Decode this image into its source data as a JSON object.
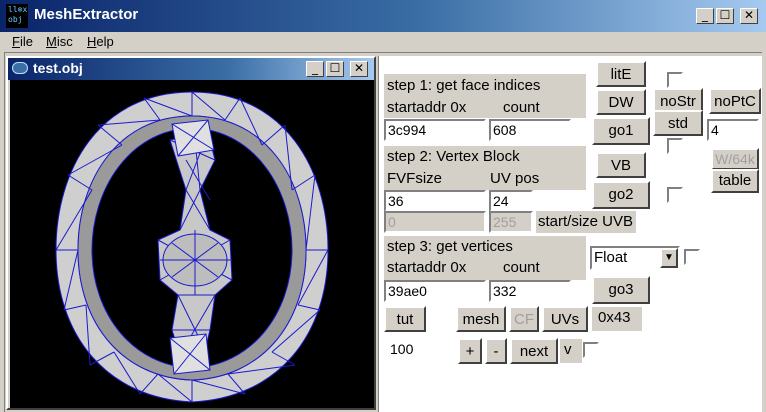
{
  "window": {
    "title": "MeshExtractor",
    "icon_text": "ll⊗x\nobj"
  },
  "caption_buttons": {
    "min": "_",
    "max": "☐",
    "close": "✕"
  },
  "menu": [
    {
      "label": "File",
      "underline": "F",
      "rest": "ile"
    },
    {
      "label": "Misc",
      "underline": "M",
      "rest": "isc"
    },
    {
      "label": "Help",
      "underline": "H",
      "rest": "elp"
    }
  ],
  "child_window": {
    "title": "test.obj"
  },
  "step1": {
    "title": "step 1: get face indices",
    "addr_label": "startaddr 0x",
    "count_label": "count",
    "addr_value": "3c994",
    "count_value": "608",
    "go_label": "go1"
  },
  "step2": {
    "title": "step 2: Vertex Block",
    "fvf_label": "FVFsize",
    "uv_label": "UV pos",
    "fvf_value": "36",
    "uv_value": "24",
    "uvb_start": "0",
    "uvb_size": "255",
    "uvb_label": "start/size UVB",
    "vb_label": "VB",
    "go_label": "go2"
  },
  "step3": {
    "title": "step 3: get vertices",
    "addr_label": "startaddr 0x",
    "count_label": "count",
    "addr_value": "39ae0",
    "count_value": "332",
    "format_value": "Float",
    "go_label": "go3"
  },
  "buttons": {
    "lite": "litE",
    "dw": "DW",
    "nostr": "noStr",
    "noptc": "noPtC",
    "std": "std",
    "w64k": "W/64k",
    "table": "table",
    "tut": "tut",
    "mesh": "mesh",
    "cf": "CF",
    "uvs": "UVs",
    "plus": "+",
    "minus": "-",
    "next": "next"
  },
  "misc": {
    "std_value": "4",
    "hex_value": "0x43",
    "step_value": "100",
    "v_label": "v"
  }
}
